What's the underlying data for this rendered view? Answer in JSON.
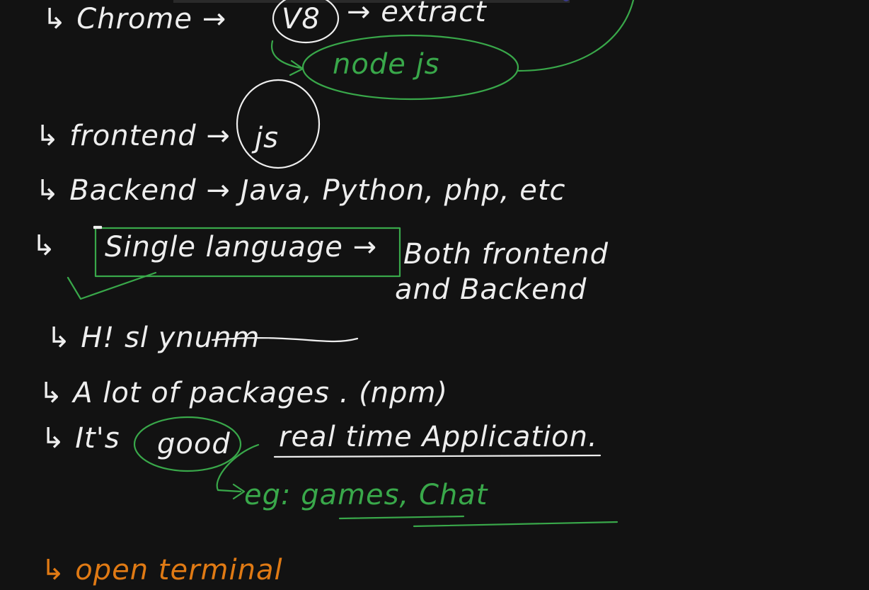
{
  "canvas": {
    "background": "#121212",
    "ink_colors": {
      "white": "#eeeeee",
      "green": "#39a84a",
      "orange": "#e07a14"
    }
  },
  "notes": {
    "line1": {
      "prefix": "↳ Chrome →",
      "boxed": "V8",
      "suffix": "→ extract",
      "callout": "node js"
    },
    "line2": {
      "prefix": "↳ frontend →",
      "boxed": "js"
    },
    "line3": {
      "text": "↳ Backend → Java, Python, php, etc"
    },
    "line4": {
      "prefix": "↳",
      "boxed": "Single language →",
      "suffix": "Both frontend",
      "continuation": "and Backend"
    },
    "line5": {
      "text": "↳ H! sl ynunm"
    },
    "line6": {
      "text": "↳ A lot of packages . (npm)"
    },
    "line7": {
      "prefix": "↳ It's",
      "boxed": "good",
      "suffix": "real time Application.",
      "example": "eg: games, Chat"
    },
    "line8": {
      "text": "↳ open terminal"
    }
  }
}
